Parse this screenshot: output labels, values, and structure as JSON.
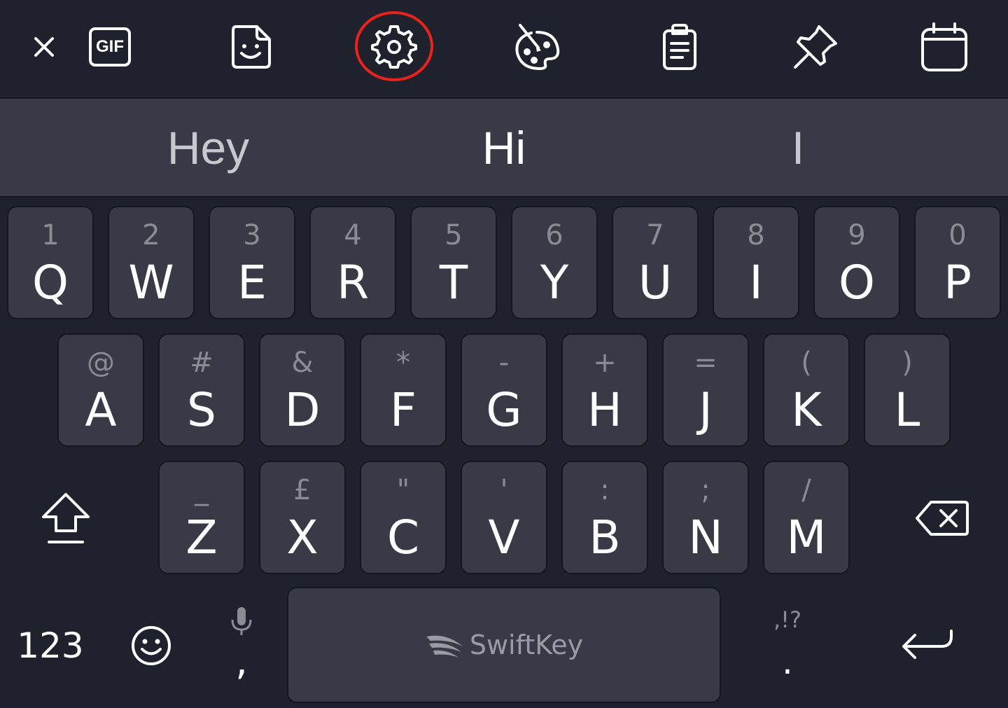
{
  "toolbar": {
    "close_icon": "close-icon",
    "gif_label": "GIF",
    "sticker_icon": "sticker-icon",
    "settings_icon": "gear-icon",
    "theme_icon": "palette-icon",
    "clipboard_icon": "clipboard-icon",
    "pin_icon": "pin-icon",
    "calendar_icon": "calendar-icon",
    "highlight_color": "#e8231b"
  },
  "predictions": [
    {
      "text": "Hey",
      "color": "#c7c8ce"
    },
    {
      "text": "Hi",
      "color": "#ffffff"
    },
    {
      "text": "I",
      "color": "#c7c8ce"
    }
  ],
  "rows": [
    [
      {
        "main": "Q",
        "hint": "1"
      },
      {
        "main": "W",
        "hint": "2"
      },
      {
        "main": "E",
        "hint": "3"
      },
      {
        "main": "R",
        "hint": "4"
      },
      {
        "main": "T",
        "hint": "5"
      },
      {
        "main": "Y",
        "hint": "6"
      },
      {
        "main": "U",
        "hint": "7"
      },
      {
        "main": "I",
        "hint": "8"
      },
      {
        "main": "O",
        "hint": "9"
      },
      {
        "main": "P",
        "hint": "0"
      }
    ],
    [
      {
        "main": "A",
        "hint": "@"
      },
      {
        "main": "S",
        "hint": "#"
      },
      {
        "main": "D",
        "hint": "&"
      },
      {
        "main": "F",
        "hint": "*"
      },
      {
        "main": "G",
        "hint": "-"
      },
      {
        "main": "H",
        "hint": "+"
      },
      {
        "main": "J",
        "hint": "="
      },
      {
        "main": "K",
        "hint": "("
      },
      {
        "main": "L",
        "hint": ")"
      }
    ],
    [
      {
        "main": "Z",
        "hint": "_"
      },
      {
        "main": "X",
        "hint": "£"
      },
      {
        "main": "C",
        "hint": "\""
      },
      {
        "main": "V",
        "hint": "'"
      },
      {
        "main": "B",
        "hint": ":"
      },
      {
        "main": "N",
        "hint": ";"
      },
      {
        "main": "M",
        "hint": "/"
      }
    ]
  ],
  "bottom": {
    "numbers_label": "123",
    "emoji_icon": "smiley-icon",
    "comma_label": ",",
    "mic_icon": "microphone-icon",
    "space_brand": "SwiftKey",
    "period_label": ".",
    "punct_hint": ",!?",
    "enter_icon": "enter-icon"
  },
  "functions": {
    "shift_icon": "shift-icon",
    "backspace_icon": "backspace-icon"
  },
  "colors": {
    "background": "#1f212c",
    "key": "#393a46",
    "key_text": "#ffffff",
    "hint_text": "#8a8b95"
  }
}
